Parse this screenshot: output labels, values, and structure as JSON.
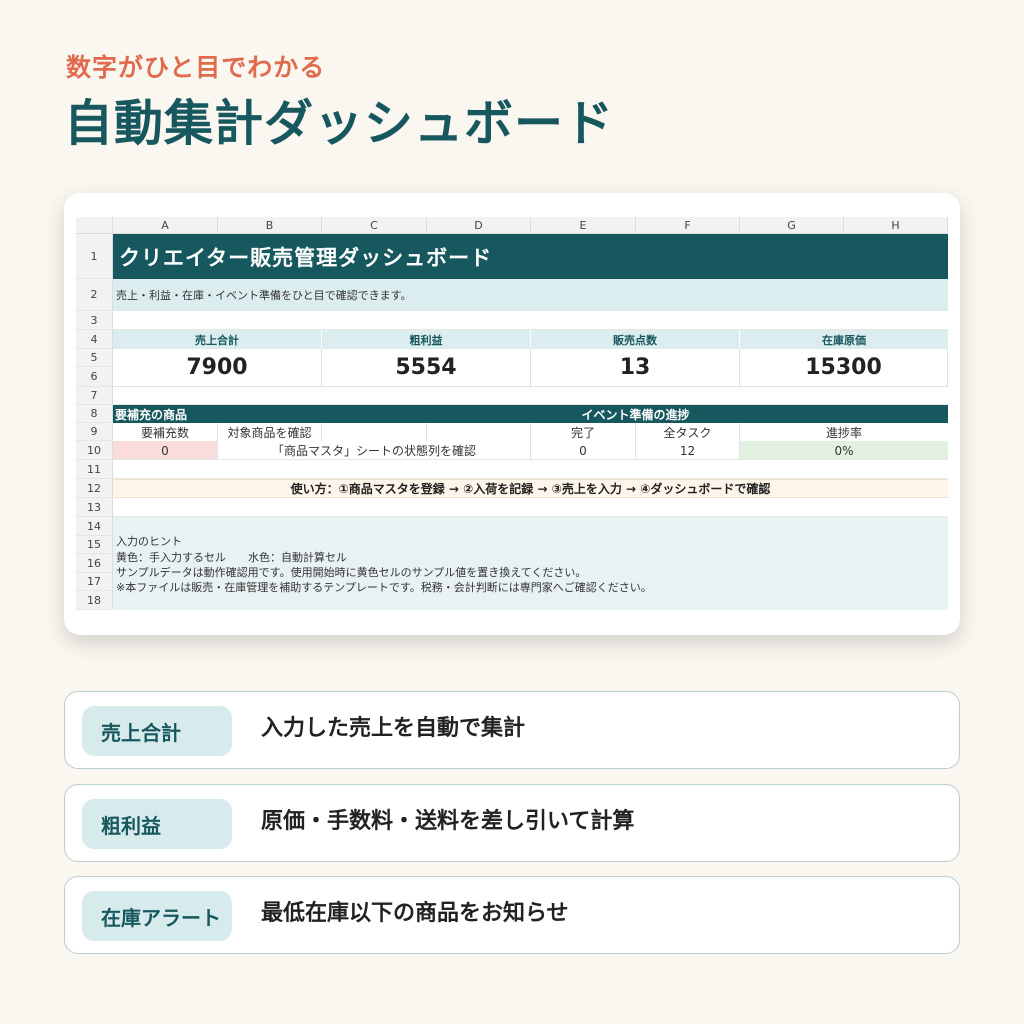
{
  "header": {
    "eyebrow": "数字がひと目でわかる",
    "headline": "自動集計ダッシュボード"
  },
  "sheet": {
    "columns": [
      "A",
      "B",
      "C",
      "D",
      "E",
      "F",
      "G",
      "H"
    ],
    "rows": [
      "1",
      "2",
      "3",
      "4",
      "5",
      "6",
      "7",
      "8",
      "9",
      "10",
      "11",
      "12",
      "13",
      "14",
      "15",
      "16",
      "17",
      "18"
    ],
    "title": "クリエイター販売管理ダッシュボード",
    "subtitle": "売上・利益・在庫・イベント準備をひと目で確認できます。",
    "kpis": [
      {
        "label": "売上合計",
        "value": "7900"
      },
      {
        "label": "粗利益",
        "value": "5554"
      },
      {
        "label": "販売点数",
        "value": "13"
      },
      {
        "label": "在庫原価",
        "value": "15300"
      }
    ],
    "restock": {
      "header": "要補充の商品",
      "count_label": "要補充数",
      "target_label": "対象商品を確認",
      "count_value": "0",
      "target_value": "「商品マスタ」シートの状態列を確認"
    },
    "event": {
      "header": "イベント準備の進捗",
      "done_label": "完了",
      "total_label": "全タスク",
      "rate_label": "進捗率",
      "done_value": "0",
      "total_value": "12",
      "rate_value": "0%"
    },
    "usage": "使い方：①商品マスタを登録 → ②入荷を記録 → ③売上を入力 → ④ダッシュボードで確認",
    "hints": [
      "入力のヒント",
      "黄色：手入力するセル　　水色：自動計算セル",
      "サンプルデータは動作確認用です。使用開始時に黄色セルのサンプル値を置き換えてください。",
      "※本ファイルは販売・在庫管理を補助するテンプレートです。税務・会計判断には専門家へご確認ください。"
    ]
  },
  "features": [
    {
      "chip": "売上合計",
      "desc": "入力した売上を自動で集計"
    },
    {
      "chip": "粗利益",
      "desc": "原価・手数料・送料を差し引いて計算"
    },
    {
      "chip": "在庫アラート",
      "desc": "最低在庫以下の商品をお知らせ"
    }
  ],
  "colors": {
    "accent": "#17585e",
    "eyebrow": "#e06b4d",
    "auto_cell": "#dcedef",
    "input_cell": "#fdf5e9",
    "alert_cell": "#fbdcdc",
    "progress_cell": "#e3f1e3"
  }
}
